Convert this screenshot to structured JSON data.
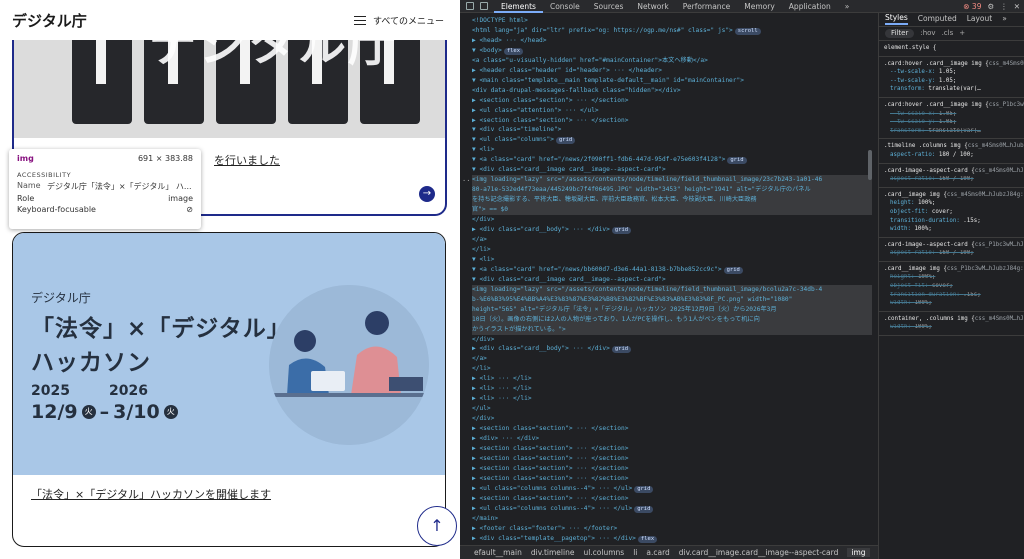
{
  "site": {
    "logo": "デジタル庁",
    "menu_label": "すべてのメニュー"
  },
  "card1": {
    "title": "を行いました",
    "arrow": "→"
  },
  "tooltip": {
    "tag": "img",
    "size": "691 × 383.88",
    "section": "ACCESSIBILITY",
    "name_label": "Name",
    "name_value": "デジタル庁「法令」×「デジタル」 ハ...",
    "role_label": "Role",
    "role_value": "image",
    "kb_label": "Keyboard-focusable",
    "kb_icon": "⊘"
  },
  "card2": {
    "banner_org": "デジタル庁",
    "banner_line1": "「法令」×「デジタル」",
    "banner_line2": "ハッカソン",
    "year1": "2025",
    "year2": "2026",
    "date_start": "12/9",
    "dow_start": "火",
    "date_sep": "–",
    "date_end": "3/10",
    "dow_end": "火",
    "title": "「法令」×「デジタル」ハッカソンを開催します"
  },
  "back_to_top": "↑",
  "devtools": {
    "tabs": [
      "Elements",
      "Console",
      "Sources",
      "Network",
      "Performance",
      "Memory",
      "Application"
    ],
    "more": "»",
    "error_count": "39",
    "gutter": "···",
    "tree": [
      {
        "t": "<!DOCTYPE html>"
      },
      {
        "t": "<html lang=\"ja\" dir=\"ltr\" prefix=\"og: https://ogp.me/ns#\" class=\" js\">",
        "pill": "scroll"
      },
      {
        "t": "▶ <head> ··· </head>"
      },
      {
        "t": "▼ <body>",
        "pill": "flex"
      },
      {
        "t": "  <a class=\"u-visually-hidden\" href=\"#mainContainer\">本文へ移動</a>"
      },
      {
        "t": "  ▶ <header class=\"header\" id=\"header\"> ··· </header>"
      },
      {
        "t": "  ▼ <main class=\"template__main template-default__main\" id=\"mainContainer\">"
      },
      {
        "t": "      <div data-drupal-messages-fallback class=\"hidden\"></div>"
      },
      {
        "t": "    ▶ <section class=\"section\"> ··· </section>"
      },
      {
        "t": "    ▶ <ul class=\"attention\"> ··· </ul>"
      },
      {
        "t": "    ▶ <section class=\"section\"> ··· </section>"
      },
      {
        "t": "    ▼ <div class=\"timeline\">"
      },
      {
        "t": "      ▼ <ul class=\"columns\">",
        "pill": "grid"
      },
      {
        "t": "        ▼ <li>"
      },
      {
        "t": "          ▼ <a class=\"card\" href=\"/news/2f090ff1-fdb6-447d-95df-e75e603f4128\">",
        "pill": "grid"
      },
      {
        "t": "            ▼ <div class=\"card__image card__image--aspect-card\">"
      },
      {
        "t": "                <img loading=\"lazy\" src=\"/assets/contents/node/timeline/field_thumbnail_image/23c7b243-1a01-46",
        "sel": true
      },
      {
        "t": "                80-a71e-532ed4f73eaa/445249bc7f4f06495.JPG\" width=\"3453\" height=\"1941\" alt=\"デジタル庁のパネル",
        "sel": true
      },
      {
        "t": "                を持ち記念撮影する、平将大臣、穂坂副大臣、岸前大臣政務官、松本大臣、今枝副大臣、川崎大臣政務",
        "sel": true
      },
      {
        "t": "                官\"> == $0",
        "sel": true
      },
      {
        "t": "              </div>"
      },
      {
        "t": "            ▶ <div class=\"card__body\"> ··· </div>",
        "pill": "grid"
      },
      {
        "t": "            </a>"
      },
      {
        "t": "          </li>"
      },
      {
        "t": "        ▼ <li>"
      },
      {
        "t": "          ▼ <a class=\"card\" href=\"/news/bb600d7-d3e6-44a1-8138-b7bbe852cc9c\">",
        "pill": "grid"
      },
      {
        "t": "            ▼ <div class=\"card__image card__image--aspect-card\">"
      },
      {
        "t": "                <img loading=\"lazy\" src=\"/assets/contents/node/timeline/field_thumbnail_image/bcolu2a7c-34db-4",
        "sel": true
      },
      {
        "t": "                b-%E6%B3%95%E4%BB%A4%E3%83%87%E3%82%B8%E3%82%BF%E3%83%AB%E3%83%8F_PC.png\" width=\"1080\"",
        "sel": true
      },
      {
        "t": "                height=\"565\" alt=\"デジタル庁「法令」×「デジタル」ハッカソン 2025年12月9日（火）から2026年3月",
        "sel": true
      },
      {
        "t": "                10日（火）。画像の右側には2人の人物が座っており、1人がPCを操作し、もう1人がペンをもって机に向",
        "sel": true
      },
      {
        "t": "                かうイラストが描かれている。\">",
        "sel": true
      },
      {
        "t": "              </div>"
      },
      {
        "t": "            ▶ <div class=\"card__body\"> ··· </div>",
        "pill": "grid"
      },
      {
        "t": "            </a>"
      },
      {
        "t": "          </li>"
      },
      {
        "t": "        ▶ <li> ··· </li>"
      },
      {
        "t": "        ▶ <li> ··· </li>"
      },
      {
        "t": "        ▶ <li> ··· </li>"
      },
      {
        "t": "        </ul>"
      },
      {
        "t": "      </div>"
      },
      {
        "t": "    ▶ <section class=\"section\"> ··· </section>"
      },
      {
        "t": "    ▶ <div> ··· </div>"
      },
      {
        "t": "    ▶ <section class=\"section\"> ··· </section>"
      },
      {
        "t": "    ▶ <section class=\"section\"> ··· </section>"
      },
      {
        "t": "    ▶ <section class=\"section\"> ··· </section>"
      },
      {
        "t": "    ▶ <section class=\"section\"> ··· </section>"
      },
      {
        "t": "    ▶ <ul class=\"columns columns--4\"> ··· </ul>",
        "pill": "grid"
      },
      {
        "t": "    ▶ <section class=\"section\"> ··· </section>"
      },
      {
        "t": "    ▶ <ul class=\"columns columns--4\"> ··· </ul>",
        "pill": "grid"
      },
      {
        "t": "    </main>"
      },
      {
        "t": "  ▶ <footer class=\"footer\"> ··· </footer>"
      },
      {
        "t": "  ▶ <div class=\"template__pagetop\"> ··· </div>",
        "pill": "flex"
      }
    ],
    "breadcrumbs": [
      "efault__main",
      "div.timeline",
      "ul.columns",
      "li",
      "a.card",
      "div.card__image.card__image--aspect-card",
      "img"
    ]
  },
  "styles": {
    "tabs": [
      "Styles",
      "Computed",
      "Layout",
      "»"
    ],
    "filter": "Filter",
    "filter_opts": [
      ":hov",
      ".cls",
      "+"
    ],
    "rules": [
      {
        "sel": "element.style {",
        "src": "",
        "props": []
      },
      {
        "sel": ".card:hover .card__image img {",
        "src": "css_m4Sms0M…hJubzJ84g:3",
        "props": [
          {
            "p": "--tw-scale-x",
            "v": "1.05;",
            "s": false
          },
          {
            "p": "--tw-scale-y",
            "v": "1.05;",
            "s": false
          },
          {
            "p": "transform",
            "v": "translate(var(…",
            "s": false
          }
        ]
      },
      {
        "sel": ".card:hover .card__image img {",
        "src": "css_P1bc3wM…hJubzJ84g:3",
        "props": [
          {
            "p": "--tw-scale-x",
            "v": "1.05;",
            "s": true
          },
          {
            "p": "--tw-scale-y",
            "v": "1.05;",
            "s": true
          },
          {
            "p": "transform",
            "v": "translate(var(…",
            "s": true
          }
        ]
      },
      {
        "sel": ".timeline .columns img {",
        "src": "css_m4Sms0M…hJubzJ84g:3",
        "props": [
          {
            "p": "aspect-ratio",
            "v": "180 / 100;",
            "s": false
          }
        ]
      },
      {
        "sel": ".card-image--aspect-card {",
        "src": "css_m4Sms0M…hJubzJ84g:2",
        "props": [
          {
            "p": "aspect-ratio",
            "v": "160 / 100;",
            "s": true
          }
        ]
      },
      {
        "sel": ".card__image img {",
        "src": "css_m4Sms0M…hJubzJ84g:3",
        "props": [
          {
            "p": "height",
            "v": "100%;",
            "s": false
          },
          {
            "p": "object-fit",
            "v": "cover;",
            "s": false
          },
          {
            "p": "transition-duration",
            "v": ".15s;",
            "s": false
          },
          {
            "p": "width",
            "v": "100%;",
            "s": false
          }
        ]
      },
      {
        "sel": ".card-image--aspect-card {",
        "src": "css_P1bc3wM…hJubzJ84g:2",
        "props": [
          {
            "p": "aspect-ratio",
            "v": "160 / 100;",
            "s": true
          }
        ]
      },
      {
        "sel": ".card__image img {",
        "src": "css_P1bc3wM…hJubzJ84g:3",
        "props": [
          {
            "p": "height",
            "v": "100%;",
            "s": true
          },
          {
            "p": "object-fit",
            "v": "cover;",
            "s": true
          },
          {
            "p": "transition-duration",
            "v": ".15s;",
            "s": true
          },
          {
            "p": "width",
            "v": "100%;",
            "s": true
          }
        ]
      },
      {
        "sel": ".container, .columns img {",
        "src": "css_m4Sms0M…hJubzJ84g:2",
        "props": [
          {
            "p": "width",
            "v": "100%;",
            "s": true
          }
        ]
      }
    ]
  }
}
